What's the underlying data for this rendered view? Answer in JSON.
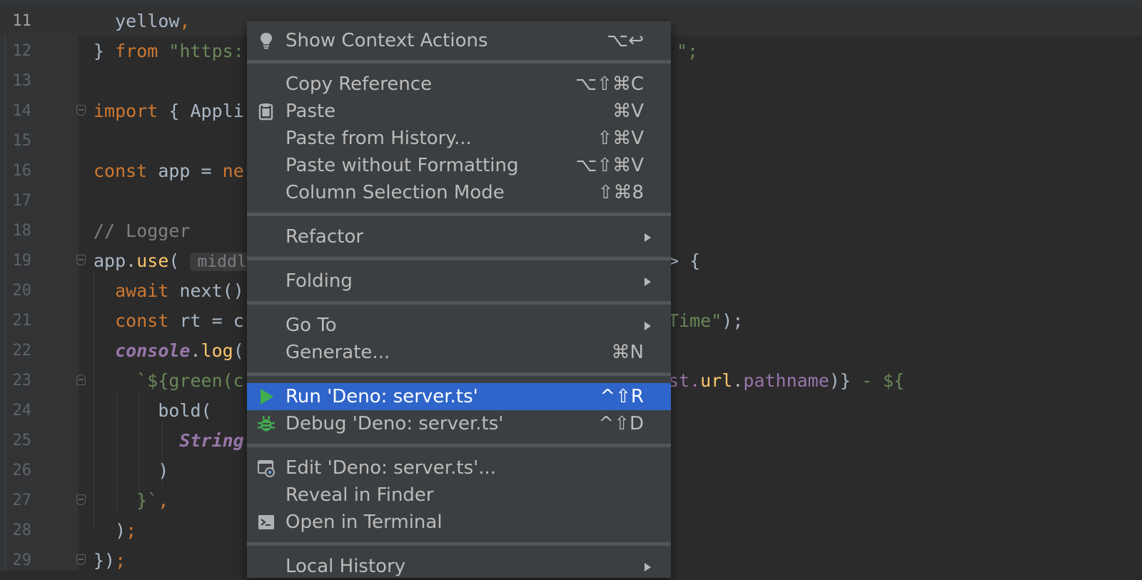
{
  "editor": {
    "lines": [
      {
        "n": "11",
        "current": true
      },
      {
        "n": "12"
      },
      {
        "n": "13"
      },
      {
        "n": "14"
      },
      {
        "n": "15"
      },
      {
        "n": "16"
      },
      {
        "n": "17"
      },
      {
        "n": "18"
      },
      {
        "n": "19"
      },
      {
        "n": "20"
      },
      {
        "n": "21"
      },
      {
        "n": "22"
      },
      {
        "n": "23"
      },
      {
        "n": "24"
      },
      {
        "n": "25"
      },
      {
        "n": "26"
      },
      {
        "n": "27"
      },
      {
        "n": "28"
      },
      {
        "n": "29"
      }
    ],
    "tokens": {
      "l11_a": "yellow",
      "l11_b": ",",
      "l12_a": "} ",
      "l12_from": "from",
      "l12_str": "\"https:",
      "l12_end": "\";",
      "l14_import": "import",
      "l14_rest": "{ Appli",
      "l16_const": "const",
      "l16_rest": "app = ",
      "l16_ne": "ne",
      "l18_cmt": "// Logger",
      "l19_app": "app.",
      "l19_use": "use",
      "l19_paren": "( ",
      "l19_hint": "middle",
      "l19_end": "> {",
      "l20_await": "await",
      "l20_rest": "next()",
      "l21_const": "const",
      "l21_rest": "rt = c",
      "l21_str": "Time\"",
      "l21_end": ");",
      "l22_console": "console",
      "l22_dot": ".",
      "l22_log": "log",
      "l22_paren": "(",
      "l23_tpl": "`${green(c",
      "l23_st": "st.",
      "l23_url": "url",
      "l23_dot": ".",
      "l23_path": "pathname",
      "l23_close": ")} ",
      "l23_dash": "- ${",
      "l24_bold": "bold(",
      "l25_string": "String",
      "l26_paren": ")",
      "l27_a": "}`",
      "l27_b": ",",
      "l28_a": ")",
      "l28_b": ";",
      "l29_a": "})",
      "l29_b": ";"
    }
  },
  "menu": {
    "items": [
      {
        "label": "Show Context Actions",
        "shortcut": "⌥↩",
        "icon": "lightbulb-icon"
      },
      {
        "label": "Copy Reference",
        "shortcut": "⌥⇧⌘C"
      },
      {
        "label": "Paste",
        "shortcut": "⌘V",
        "icon": "clipboard-icon"
      },
      {
        "label": "Paste from History...",
        "shortcut": "⇧⌘V"
      },
      {
        "label": "Paste without Formatting",
        "shortcut": "⌥⇧⌘V"
      },
      {
        "label": "Column Selection Mode",
        "shortcut": "⇧⌘8"
      },
      {
        "label": "Refactor",
        "submenu": true
      },
      {
        "label": "Folding",
        "submenu": true
      },
      {
        "label": "Go To",
        "submenu": true
      },
      {
        "label": "Generate...",
        "shortcut": "⌘N"
      },
      {
        "label": "Run 'Deno: server.ts'",
        "shortcut": "^⇧R",
        "icon": "run-icon",
        "selected": true
      },
      {
        "label": "Debug 'Deno: server.ts'",
        "shortcut": "^⇧D",
        "icon": "bug-icon"
      },
      {
        "label": "Edit 'Deno: server.ts'...",
        "icon": "edit-config-icon"
      },
      {
        "label": "Reveal in Finder"
      },
      {
        "label": "Open in Terminal",
        "icon": "terminal-icon"
      },
      {
        "label": "Local History",
        "submenu": true
      }
    ]
  },
  "colors": {
    "accent_selected": "#2f65ca",
    "menu_bg": "#3c3f41",
    "editor_bg": "#2b2b2b",
    "run_green": "#3fae4e",
    "debug_green": "#44a852"
  }
}
